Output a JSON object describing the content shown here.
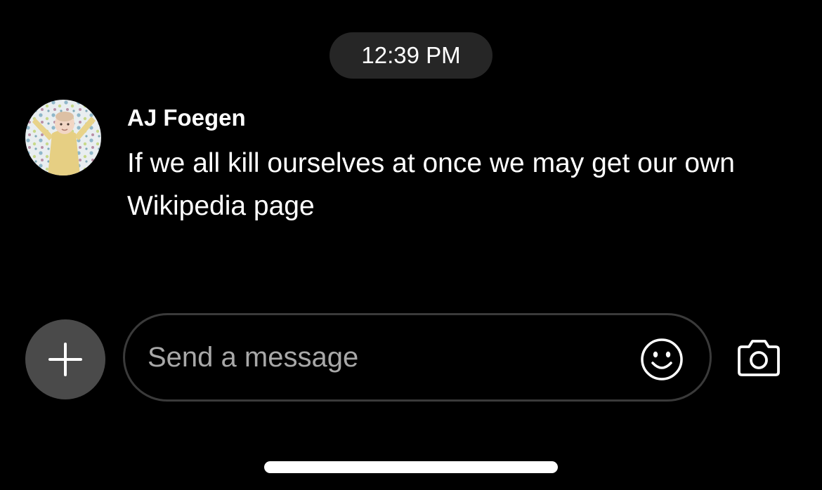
{
  "chat": {
    "timestamp": "12:39 PM",
    "messages": [
      {
        "sender": "AJ Foegen",
        "text": "If we all kill ourselves at once we may get our own Wikipedia page"
      }
    ]
  },
  "composer": {
    "placeholder": "Send a message",
    "value": "",
    "add_icon": "plus-icon",
    "emoji_icon": "smiley-icon",
    "camera_icon": "camera-icon"
  },
  "colors": {
    "background": "#000000",
    "pill": "#262626",
    "add_button": "#4a4a4a",
    "input_border": "#3a3a3a",
    "placeholder": "#a8a8a8"
  }
}
